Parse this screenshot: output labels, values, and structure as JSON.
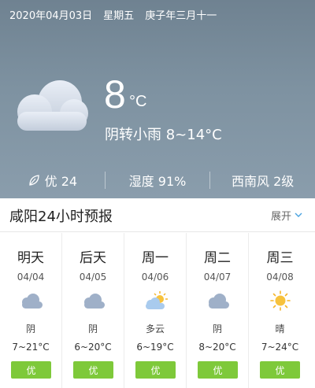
{
  "header": {
    "date": "2020年04月03日",
    "weekday": "星期五",
    "lunar": "庚子年三月十一"
  },
  "current": {
    "temperature": "8",
    "unit": "°C",
    "condition": "阴转小雨 8~14°C",
    "icon": "cloud-icon"
  },
  "stats": {
    "air_quality": "优 24",
    "humidity": "湿度 91%",
    "wind": "西南风 2级"
  },
  "forecast": {
    "title": "咸阳24小时预报",
    "toggle_label": "展开",
    "days": [
      {
        "name": "明天",
        "date": "04/04",
        "icon": "cloud-icon",
        "desc": "阴",
        "temp": "7~21°C",
        "aqi": "优"
      },
      {
        "name": "后天",
        "date": "04/05",
        "icon": "cloud-icon",
        "desc": "阴",
        "temp": "6~20°C",
        "aqi": "优"
      },
      {
        "name": "周一",
        "date": "04/06",
        "icon": "partly-cloudy-icon",
        "desc": "多云",
        "temp": "6~19°C",
        "aqi": "优"
      },
      {
        "name": "周二",
        "date": "04/07",
        "icon": "cloud-icon",
        "desc": "阴",
        "temp": "8~20°C",
        "aqi": "优"
      },
      {
        "name": "周三",
        "date": "04/08",
        "icon": "sun-icon",
        "desc": "晴",
        "temp": "7~24°C",
        "aqi": "优"
      }
    ]
  },
  "colors": {
    "aqi_good": "#7ec93a",
    "hero_bg": "#7e92a1"
  }
}
